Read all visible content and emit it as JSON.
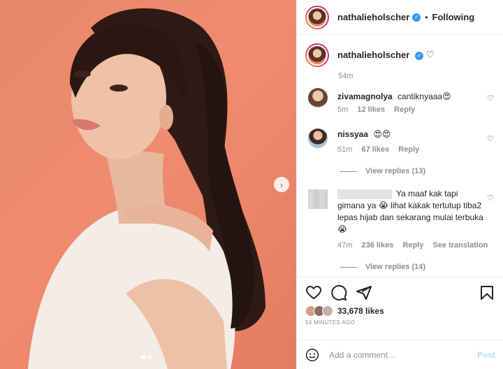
{
  "post": {
    "author": "nathalieholscher",
    "follow_separator": "•",
    "follow_status": "Following",
    "caption_time": "54m",
    "image_alt": "Portrait photo",
    "slide_count": 2,
    "active_slide": 1
  },
  "comments": [
    {
      "user": "zivamagnolya",
      "text": "cantiknyaaa😍",
      "time": "5m",
      "likes": "12 likes",
      "reply": "Reply"
    },
    {
      "user": "nissyaa",
      "text": "😍😍",
      "time": "51m",
      "likes": "67 likes",
      "reply": "Reply",
      "view_replies": "View replies (13)"
    },
    {
      "user": "",
      "text": "Ya maaf kak tapi gimana ya 😭 lihat kakak tertutup tiba2 lepas hijab dan sekarang mulai terbuka 😭",
      "time": "47m",
      "likes": "236 likes",
      "reply": "Reply",
      "translate": "See translation",
      "view_replies": "View replies (14)"
    }
  ],
  "actions": {
    "likes_count": "33,678",
    "likes_suffix": "likes",
    "timestamp": "54 MINUTES AGO"
  },
  "add_comment": {
    "placeholder": "Add a comment…",
    "post_label": "Post"
  },
  "colors": {
    "accent": "#3897f0",
    "post_disabled": "#b2dffc",
    "background_photo": "#e8876a"
  }
}
